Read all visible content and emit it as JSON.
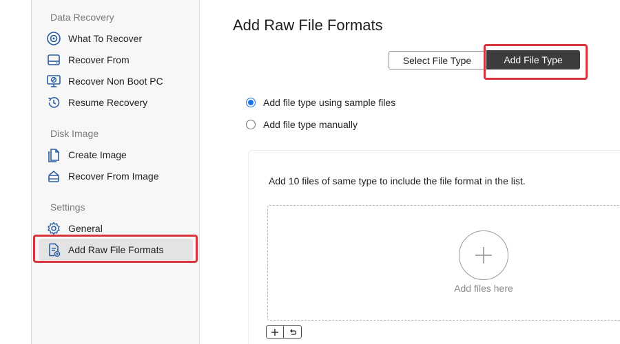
{
  "sidebar": {
    "sections": [
      {
        "title": "Data Recovery",
        "items": [
          {
            "label": "What To Recover",
            "icon": "target-icon"
          },
          {
            "label": "Recover From",
            "icon": "drive-icon"
          },
          {
            "label": "Recover Non Boot PC",
            "icon": "monitor-blocked-icon"
          },
          {
            "label": "Resume Recovery",
            "icon": "history-icon"
          }
        ]
      },
      {
        "title": "Disk Image",
        "items": [
          {
            "label": "Create Image",
            "icon": "document-copy-icon"
          },
          {
            "label": "Recover From Image",
            "icon": "drive-restore-icon"
          }
        ]
      },
      {
        "title": "Settings",
        "items": [
          {
            "label": "General",
            "icon": "gear-icon"
          },
          {
            "label": "Add Raw File Formats",
            "icon": "document-add-icon",
            "active": true
          }
        ]
      }
    ]
  },
  "main": {
    "title": "Add Raw File Formats",
    "segmented": {
      "select_label": "Select File Type",
      "add_label": "Add File Type",
      "selected": "Add File Type"
    },
    "options": [
      {
        "label": "Add file type using sample files",
        "checked": true
      },
      {
        "label": "Add file type manually",
        "checked": false
      }
    ],
    "card": {
      "description": "Add 10 files of same type to include the file format in the list.",
      "dropzone_label": "Add files here"
    },
    "toolbar": {
      "add_icon": "plus-icon",
      "undo_icon": "undo-icon"
    }
  },
  "colors": {
    "accent": "#1a73e8",
    "highlight": "#d6333c",
    "selected_button": "#3c3c3c",
    "sidebar_bg": "#f7f7f8"
  }
}
